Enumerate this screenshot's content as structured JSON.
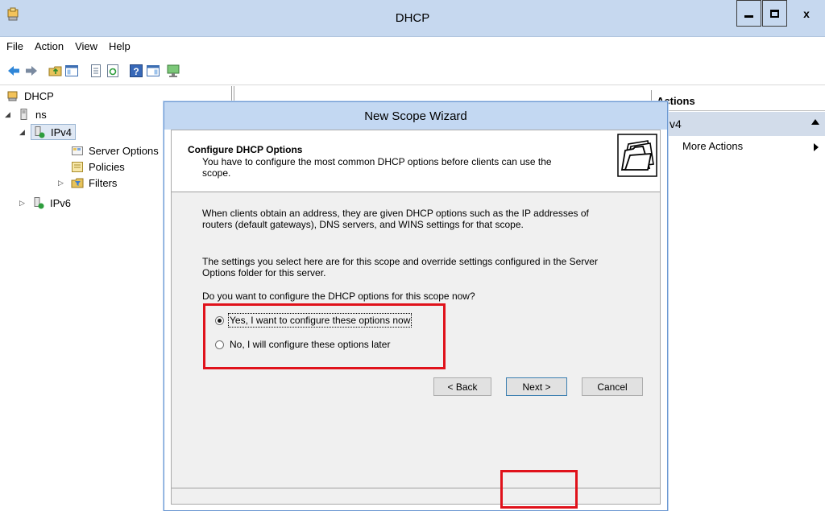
{
  "window": {
    "title": "DHCP",
    "minimize_icon": "minimize-icon",
    "maximize_icon": "maximize-icon",
    "close_glyph": "x"
  },
  "menu": [
    "File",
    "Action",
    "View",
    "Help"
  ],
  "toolbar": {
    "icons": [
      "back-arrow-icon",
      "forward-arrow-icon",
      "up-folder-icon",
      "show-hide-tree-icon",
      "properties-icon",
      "refresh-icon",
      "help-icon",
      "show-hide-action-pane-icon",
      "monitor-icon"
    ]
  },
  "tree": {
    "root": "DHCP",
    "server": "ns",
    "ipv4": "IPv4",
    "server_options": "Server Options",
    "policies": "Policies",
    "filters": "Filters",
    "ipv6": "IPv6"
  },
  "actions": {
    "header": "Actions",
    "section": "v4",
    "more_actions": "More Actions"
  },
  "wizard": {
    "title": "New Scope Wizard",
    "header_title": "Configure DHCP Options",
    "header_subtitle": "You have to configure the most common DHCP options before clients can use the scope.",
    "para1": "When clients obtain an address, they are given DHCP options such as the IP addresses of routers (default gateways), DNS servers, and WINS settings for that scope.",
    "para2": "The settings you select here are for this scope and override settings configured in the Server Options folder for this server.",
    "question": "Do you want to configure the DHCP options for this scope now?",
    "option_yes": "Yes, I want to configure these options now",
    "option_no": "No, I will configure these options later",
    "selected_option": "yes",
    "back_label": "< Back",
    "next_label": "Next >",
    "cancel_label": "Cancel"
  },
  "colors": {
    "highlight": "#e0121b",
    "titlebar": "#c6d8ef",
    "wizard_titlebar": "#c3d8f2"
  }
}
